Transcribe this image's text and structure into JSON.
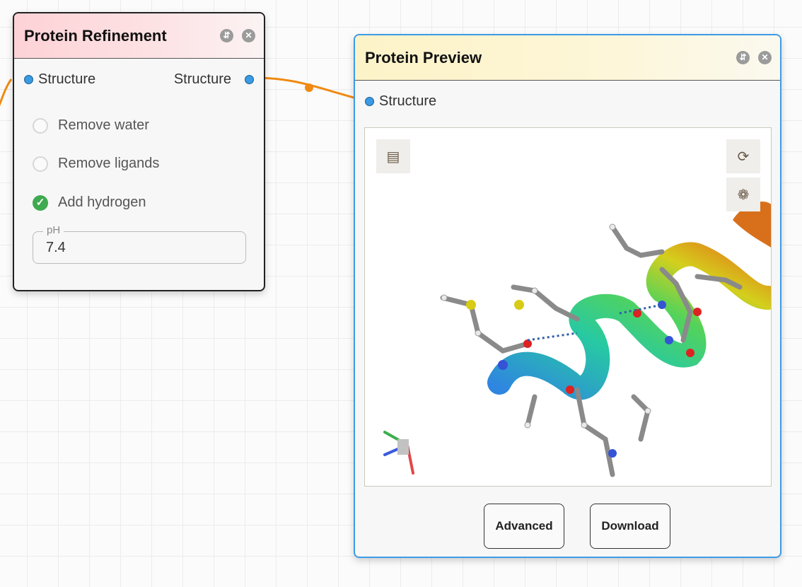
{
  "refine_node": {
    "title": "Protein Refinement",
    "input_port": "Structure",
    "output_port": "Structure",
    "options": [
      {
        "label": "Remove water",
        "checked": false
      },
      {
        "label": "Remove ligands",
        "checked": false
      },
      {
        "label": "Add hydrogen",
        "checked": true
      }
    ],
    "ph_label": "pH",
    "ph_value": "7.4"
  },
  "preview_node": {
    "title": "Protein Preview",
    "input_port": "Structure",
    "buttons": {
      "advanced": "Advanced",
      "download": "Download"
    }
  },
  "colors": {
    "accent": "#3c9be6",
    "port": "#3a9ae3",
    "edge": "#f08a12",
    "check": "#3faa4f"
  },
  "icons": [
    "collapse-icon",
    "close-icon",
    "animation-icon",
    "reset-view-icon",
    "screenshot-icon",
    "axes-icon"
  ]
}
